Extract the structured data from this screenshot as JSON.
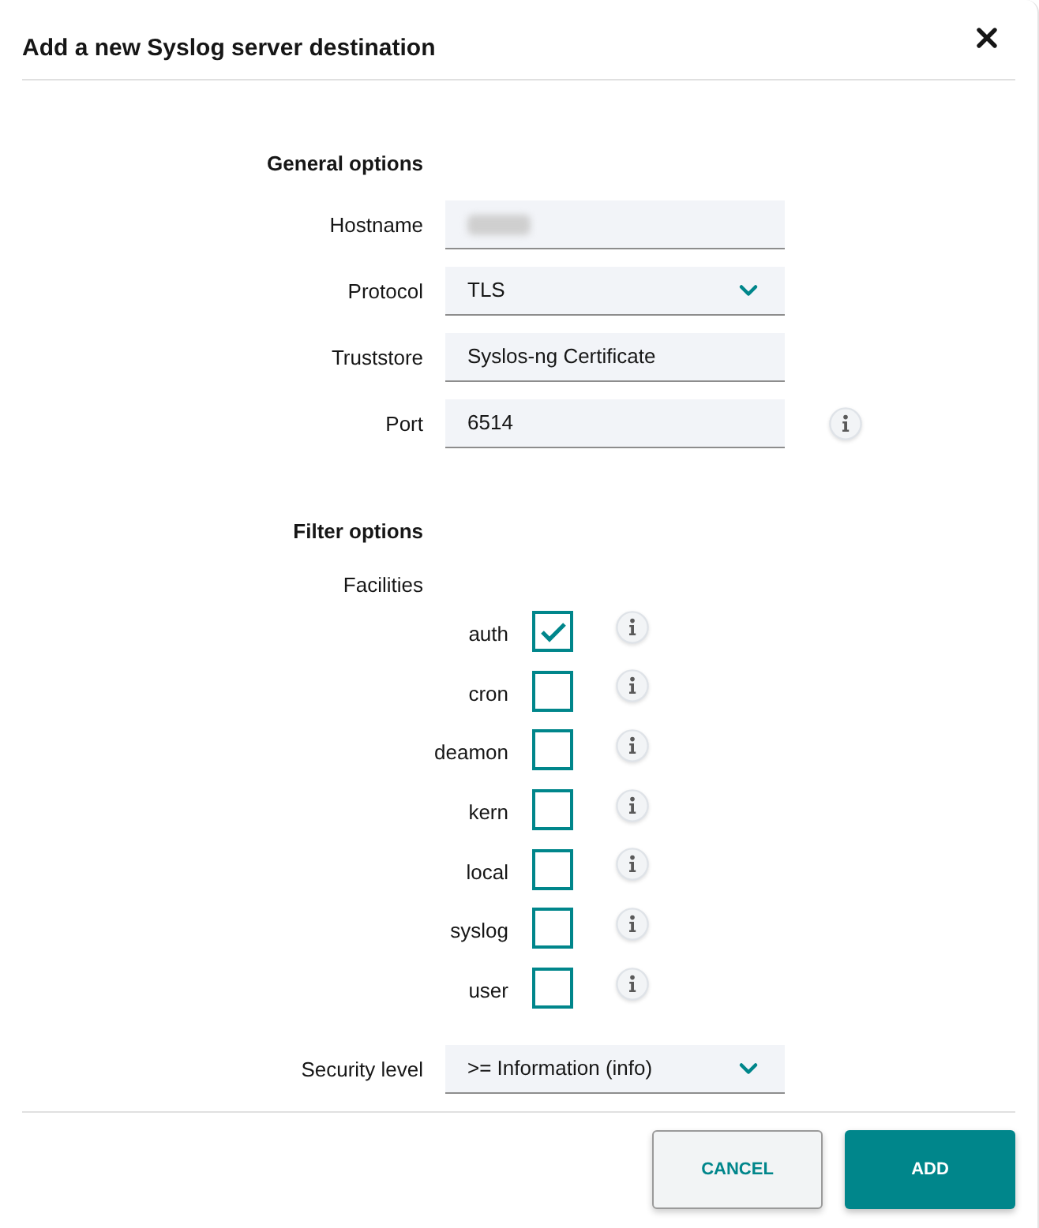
{
  "dialog": {
    "title": "Add a new Syslog server destination"
  },
  "general_options": {
    "heading": "General options",
    "fields": [
      {
        "kind": "text",
        "label": "Hostname",
        "redacted": true,
        "info": false
      },
      {
        "kind": "select",
        "label": "Protocol",
        "value": "TLS",
        "info": false
      },
      {
        "kind": "text",
        "label": "Truststore",
        "value": "Syslos-ng Certificate",
        "info": false
      },
      {
        "kind": "text",
        "label": "Port",
        "value": "6514",
        "info": true
      }
    ]
  },
  "filter_options": {
    "heading": "Filter options",
    "facilities_label": "Facilities",
    "facilities": [
      {
        "label": "auth",
        "checked": true,
        "info": true
      },
      {
        "label": "cron",
        "checked": false,
        "info": true
      },
      {
        "label": "deamon",
        "checked": false,
        "info": true
      },
      {
        "label": "kern",
        "checked": false,
        "info": true
      },
      {
        "label": "local",
        "checked": false,
        "info": true
      },
      {
        "label": "syslog",
        "checked": false,
        "info": true
      },
      {
        "label": "user",
        "checked": false,
        "info": true
      }
    ],
    "security_level": {
      "kind": "select",
      "label": "Security level",
      "value": ">= Information (info)"
    }
  },
  "buttons": [
    {
      "kind": "secondary",
      "label": "CANCEL"
    },
    {
      "kind": "primary",
      "label": "ADD"
    }
  ]
}
